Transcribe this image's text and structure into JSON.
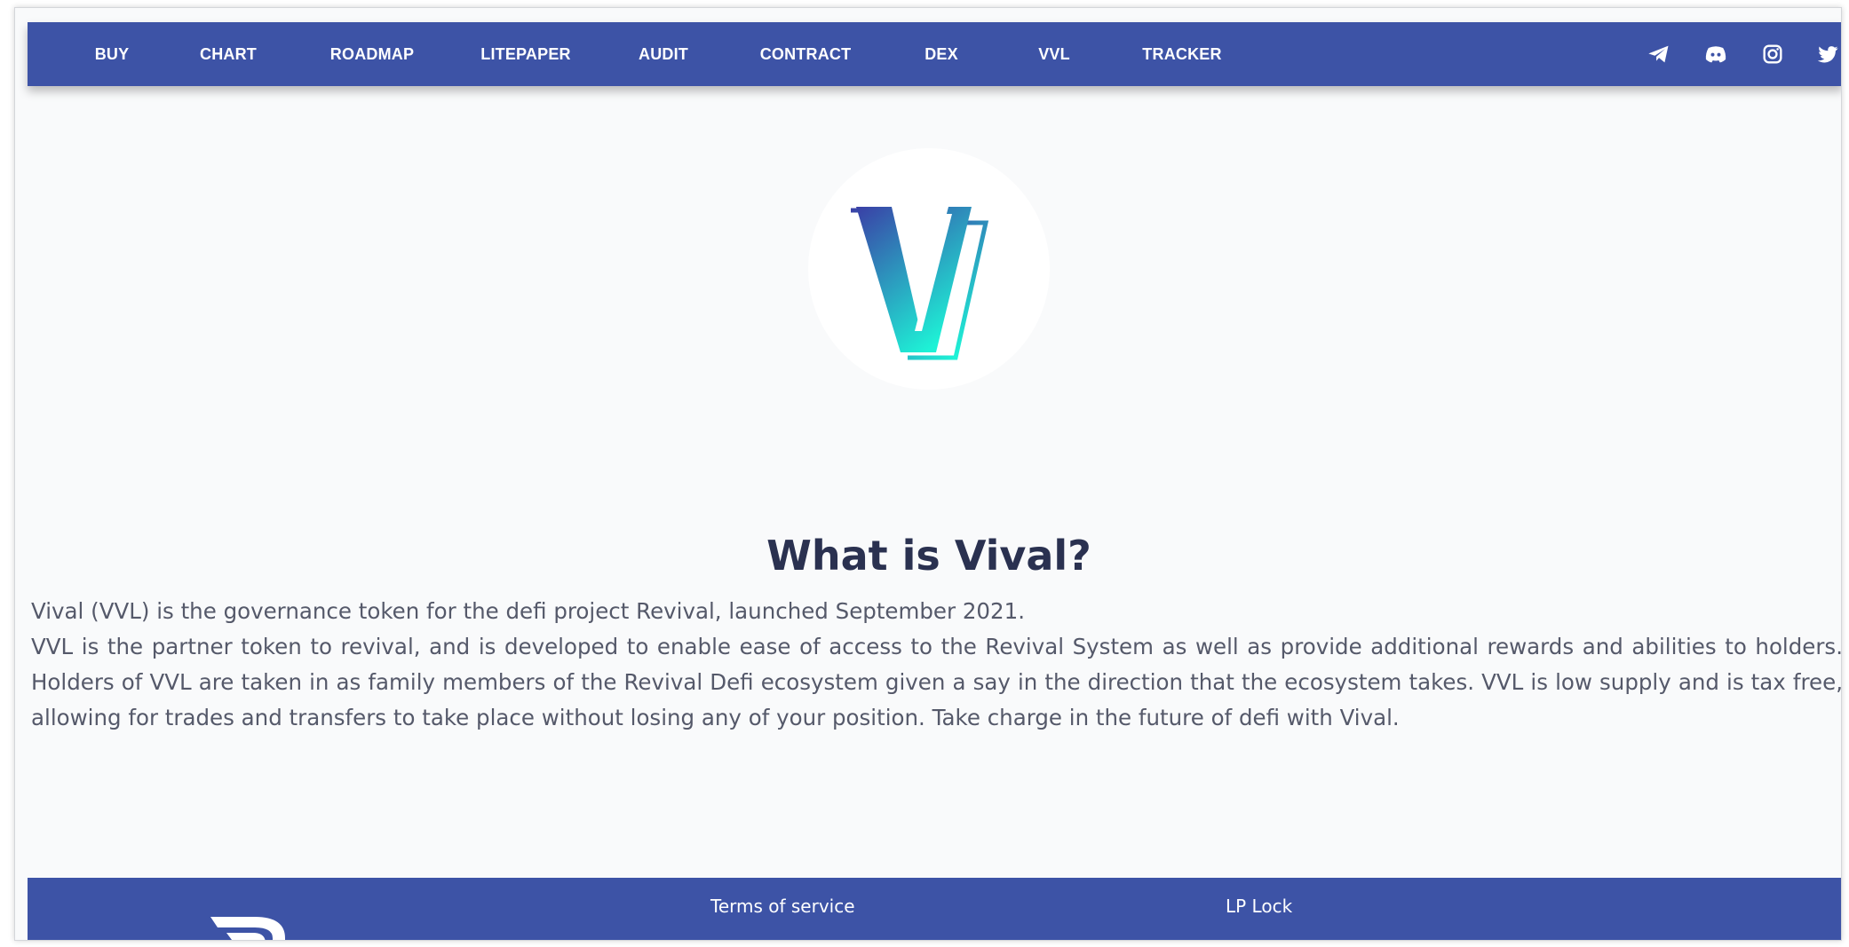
{
  "nav": {
    "items": [
      "BUY",
      "CHART",
      "ROADMAP",
      "LITEPAPER",
      "AUDIT",
      "CONTRACT",
      "DEX",
      "VVL",
      "TRACKER"
    ],
    "social_icons": [
      "telegram-icon",
      "discord-icon",
      "instagram-icon",
      "twitter-icon"
    ]
  },
  "main": {
    "title": "What is Vival?",
    "paragraph_1": "Vival (VVL) is the governance token for the defi project Revival, launched September 2021.",
    "paragraph_2": "VVL is the partner token to revival, and is developed to enable ease of access to the Revival System as well as provide additional rewards and abilities to holders. Holders of VVL are taken in as family members of the Revival Defi ecosystem given a say in the direction that the ecosystem takes. VVL is low supply and is tax free, allowing for trades and transfers to take place without losing any of your position. Take charge in the future of defi with Vival."
  },
  "footer": {
    "links": [
      "Terms of service",
      "LP Lock"
    ]
  },
  "colors": {
    "primary": "#3d53a6",
    "page_background": "#f9fafb",
    "title": "#2a3150",
    "body_text": "#55596a",
    "logo_gradient_start": "#3a3fa6",
    "logo_gradient_end": "#1ef2d6"
  }
}
